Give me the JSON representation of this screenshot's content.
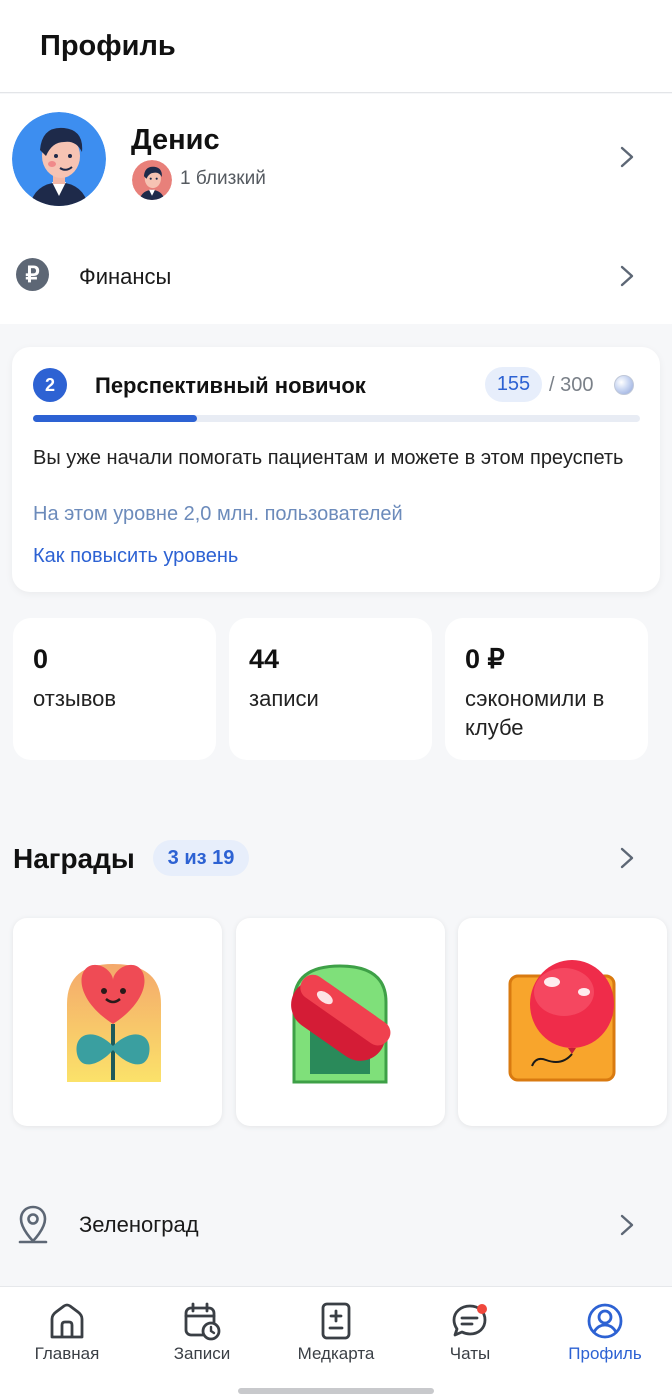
{
  "header": {
    "title": "Профиль"
  },
  "profile": {
    "name": "Денис",
    "subtitle": "1 близкий"
  },
  "finance": {
    "label": "Финансы",
    "icon_symbol": "₽",
    "icon": "ruble-icon"
  },
  "level": {
    "number": "2",
    "title": "Перспективный новичок",
    "points": "155",
    "points_total": "/ 300",
    "progress": 0.27,
    "description": "Вы уже начали помогать пациентам и можете в этом преуспеть",
    "users_note": "На этом уровне 2,0 млн. пользователей",
    "link": "Как повысить уровень"
  },
  "stats": [
    {
      "value": "0",
      "label": "отзывов"
    },
    {
      "value": "44",
      "label": "записи"
    },
    {
      "value": "0 ₽",
      "label": "сэкономили в клубе"
    }
  ],
  "awards": {
    "title": "Награды",
    "count": "3 из 19",
    "items": [
      {
        "name": "heart-flower-badge"
      },
      {
        "name": "pill-badge"
      },
      {
        "name": "balloon-badge"
      }
    ]
  },
  "city": {
    "label": "Зеленоград",
    "icon": "location-pin-icon"
  },
  "tabbar": {
    "items": [
      {
        "label": "Главная",
        "icon": "home-icon"
      },
      {
        "label": "Записи",
        "icon": "calendar-clock-icon"
      },
      {
        "label": "Медкарта",
        "icon": "medcard-icon"
      },
      {
        "label": "Чаты",
        "icon": "chat-icon"
      },
      {
        "label": "Профиль",
        "icon": "profile-icon"
      }
    ],
    "active_index": 4
  },
  "colors": {
    "accent": "#2d62d3",
    "background": "#f6f7f9",
    "notification": "#f0473c"
  }
}
